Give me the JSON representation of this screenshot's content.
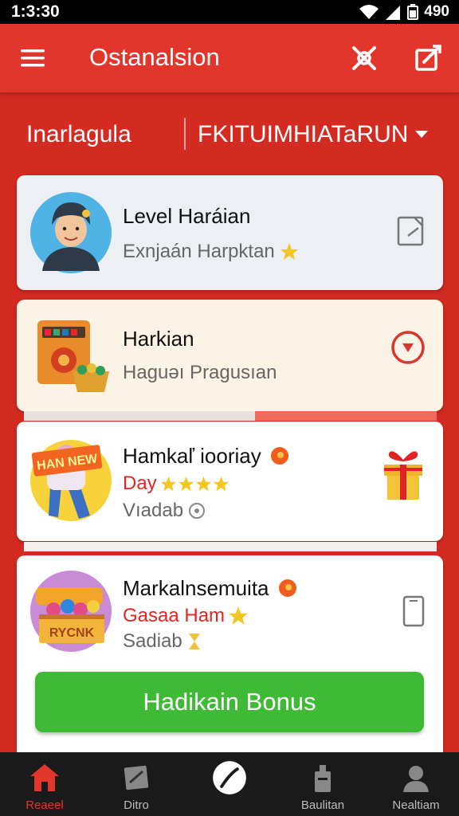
{
  "status_bar": {
    "time": "1:3:30",
    "battery_text": "490"
  },
  "app_bar": {
    "title": "Ostanalsion"
  },
  "filter": {
    "left_label": "Inarlagula",
    "right_label": "FKITUIMHIATaRUN"
  },
  "cards": [
    {
      "title": "Level Haráian",
      "subtitle": "Exnjaán Harpktan",
      "action_icon": "edit-doc-icon",
      "thumb_icon": "avatar"
    },
    {
      "title": "Harkian",
      "subtitle": "Haguǝı Pragusıan",
      "action_icon": "play-circle-icon",
      "thumb_icon": "slot-machine"
    },
    {
      "title": "Hamkaľ iooriay",
      "tag": "Day",
      "meta": "Vıadab",
      "rating": 4,
      "action_icon": "gift-icon",
      "thumb_icon": "character-sign",
      "thumb_sign": "HAN NEW"
    },
    {
      "title": "Markalnsemuita",
      "tag": "Gasaa Ham",
      "meta": "Sadiab",
      "action_icon": "phone-icon",
      "thumb_icon": "treasure-chest",
      "thumb_sign": "RYCNK"
    }
  ],
  "bonus_button": {
    "label": "Hadikain Bonus"
  },
  "bottom_nav": [
    {
      "label": "Reaeel",
      "icon": "home-icon",
      "active": true
    },
    {
      "label": "Ditro",
      "icon": "note-icon",
      "active": false
    },
    {
      "label": "",
      "icon": "compass-icon",
      "active": false
    },
    {
      "label": "Baulitan",
      "icon": "shop-icon",
      "active": false
    },
    {
      "label": "Nealtiam",
      "icon": "profile-icon",
      "active": false
    }
  ],
  "colors": {
    "primary": "#e2362c",
    "background": "#d32a22",
    "bonus": "#3fba36",
    "tag": "#e12424"
  }
}
